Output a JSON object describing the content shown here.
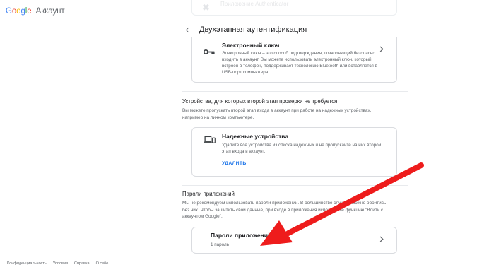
{
  "logo": {
    "brand": [
      "G",
      "o",
      "o",
      "g",
      "l",
      "e"
    ],
    "product": "Аккаунт"
  },
  "faded_card": {
    "title": "Приложение Authenticator"
  },
  "header": {
    "title": "Двухэтапная аутентификация"
  },
  "security_key": {
    "title": "Электронный ключ",
    "description": "Электронный ключ – это способ подтверждения, позволяющий безопасно входить в аккаунт. Вы можете использовать электронный ключ, который встроен в телефон, поддерживает технологию Bluetooth или вставляется в USB-порт компьютера."
  },
  "devices_section": {
    "heading": "Устройства, для которых второй этап проверки не требуется",
    "text": "Вы можете пропускать второй этап входа в аккаунт при работе на надежных устройствах, например на личном компьютере.",
    "card": {
      "title": "Надежные устройства",
      "description": "Удалите все устройства из списка надежных и не пропускайте на них второй этап входа в аккаунт.",
      "action": "УДАЛИТЬ"
    }
  },
  "app_passwords_section": {
    "heading": "Пароли приложений",
    "text": "Мы не рекомендуем использовать пароли приложений. В большинстве случаев можно обойтись без них. Чтобы защитить свои данные, при входе в приложения используйте функцию \"Войти с аккаунтом Google\".",
    "card": {
      "title": "Пароли приложений",
      "count": "1 пароль"
    }
  },
  "footer": {
    "links": [
      "Конфиденциальность",
      "Условия",
      "Справка",
      "О себе"
    ]
  },
  "colors": {
    "annotation_arrow": "#ee1c1c",
    "link": "#1a73e8"
  },
  "icons": [
    "back-arrow-icon",
    "key-icon",
    "laptop-phone-icon",
    "chevron-right-icon"
  ]
}
